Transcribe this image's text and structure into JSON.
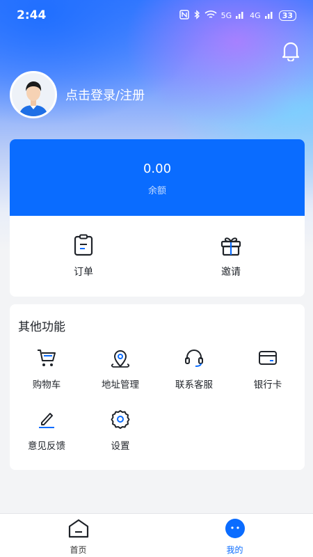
{
  "status_bar": {
    "time": "2:44",
    "network_1": "5G",
    "network_2": "4G",
    "battery": "33"
  },
  "header": {
    "login_text": "点击登录/注册"
  },
  "wallet": {
    "balance_value": "0.00",
    "balance_label": "余额",
    "accent_color": "#0a6cff"
  },
  "quick_actions": [
    {
      "label": "订单",
      "icon": "clipboard-icon"
    },
    {
      "label": "邀请",
      "icon": "gift-icon"
    }
  ],
  "other_features": {
    "title": "其他功能",
    "items": [
      {
        "label": "购物车",
        "icon": "cart-icon"
      },
      {
        "label": "地址管理",
        "icon": "location-pin-icon"
      },
      {
        "label": "联系客服",
        "icon": "headset-icon"
      },
      {
        "label": "银行卡",
        "icon": "card-icon"
      },
      {
        "label": "意见反馈",
        "icon": "edit-icon"
      },
      {
        "label": "设置",
        "icon": "gear-icon"
      }
    ]
  },
  "tabbar": {
    "items": [
      {
        "label": "首页",
        "icon": "home-icon",
        "active": false
      },
      {
        "label": "我的",
        "icon": "profile-face-icon",
        "active": true
      }
    ]
  }
}
